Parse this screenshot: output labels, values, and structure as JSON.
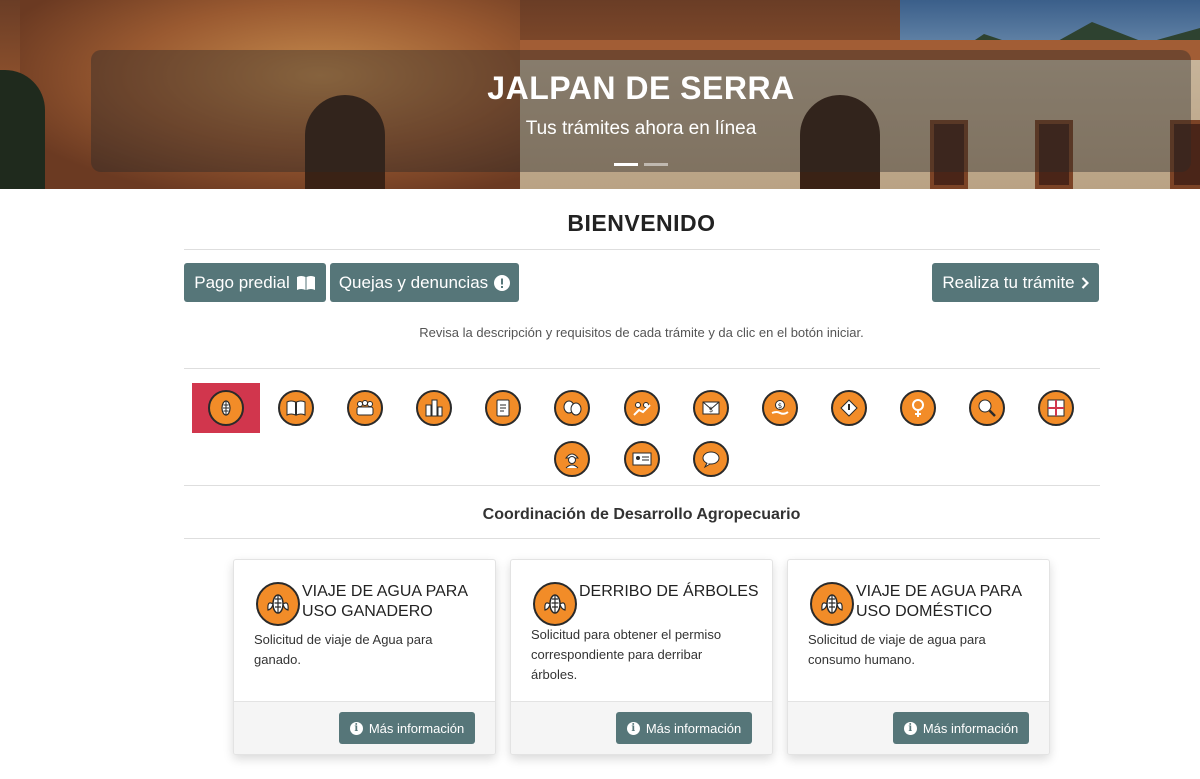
{
  "hero": {
    "title": "JALPAN DE SERRA",
    "subtitle": "Tus trámites ahora en línea",
    "slides": 2,
    "active_slide": 1
  },
  "welcome": "BIENVENIDO",
  "buttons": {
    "pago_predial": "Pago predial",
    "quejas": "Quejas y denuncias",
    "realiza": "Realiza tu trámite"
  },
  "hint": "Revisa la descripción y requisitos de cada trámite y da clic en el botón iniciar.",
  "categories": [
    {
      "icon": "agriculture-icon",
      "selected": true
    },
    {
      "icon": "book-icon"
    },
    {
      "icon": "community-icon"
    },
    {
      "icon": "city-icon"
    },
    {
      "icon": "clipboard-icon"
    },
    {
      "icon": "theater-masks-icon"
    },
    {
      "icon": "people-growth-icon"
    },
    {
      "icon": "money-envelope-icon"
    },
    {
      "icon": "money-hand-icon"
    },
    {
      "icon": "construction-sign-icon"
    },
    {
      "icon": "female-icon"
    },
    {
      "icon": "search-eye-icon"
    },
    {
      "icon": "urban-planning-icon"
    },
    {
      "icon": "worker-icon"
    },
    {
      "icon": "id-card-icon"
    },
    {
      "icon": "chat-bubble-icon"
    }
  ],
  "section_title": "Coordinación de Desarrollo Agropecuario",
  "cards": [
    {
      "title": "VIAJE DE AGUA PARA USO GANADERO",
      "description": "Solicitud de viaje de Agua para ganado.",
      "button": "Más información"
    },
    {
      "title": "DERRIBO DE ÁRBOLES",
      "description": "Solicitud para obtener el permiso correspondiente para derribar árboles.",
      "button": "Más información"
    },
    {
      "title": "VIAJE DE AGUA PARA USO DOMÉSTICO",
      "description": "Solicitud de viaje de agua para consumo humano.",
      "button": "Más información"
    }
  ],
  "colors": {
    "button": "#567679",
    "icon_fill": "#f28c28",
    "selected_category": "#d1364d"
  }
}
